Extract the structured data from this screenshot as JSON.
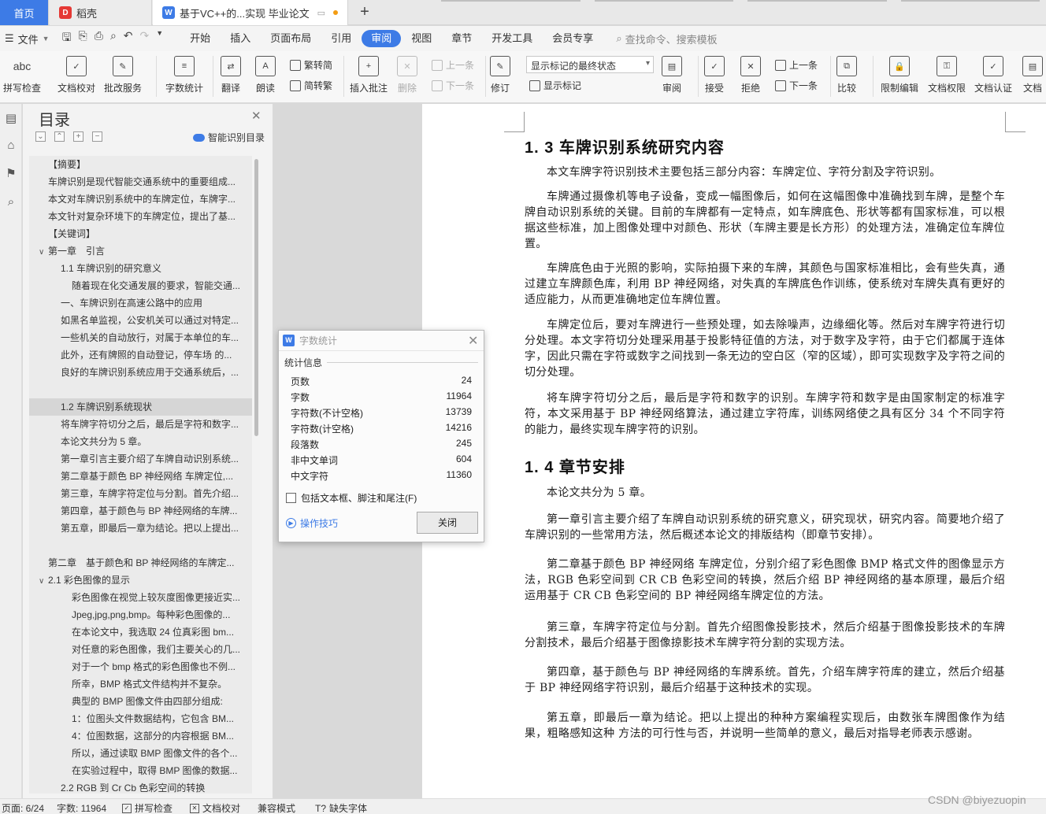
{
  "tabs": {
    "home": "首页",
    "docer": "稻壳",
    "doc": "基于VC++的...实现 毕业论文",
    "new_tab": "+"
  },
  "menu": {
    "file": "文件",
    "items": [
      "开始",
      "插入",
      "页面布局",
      "引用",
      "审阅",
      "视图",
      "章节",
      "开发工具",
      "会员专享"
    ],
    "active": "审阅",
    "search": "查找命令、搜索模板"
  },
  "ribbon": {
    "spell": "拼写检查",
    "proof": "文档校对",
    "review_svc": "批改服务",
    "wordcount": "字数统计",
    "translate": "翻译",
    "read_aloud": "朗读",
    "trad": "繁转简",
    "simp": "简转繁",
    "insert_comment": "插入批注",
    "delete": "删除",
    "prev_c": "上一条",
    "next_c": "下一条",
    "track": "修订",
    "mode": "显示标记的最终状态",
    "show_markup": "显示标记",
    "review": "审阅",
    "accept": "接受",
    "reject": "拒绝",
    "prev": "上一条",
    "next": "下一条",
    "compare": "比较",
    "restrict": "限制编辑",
    "perm": "文档权限",
    "cert": "文档认证",
    "doc_more": "文档"
  },
  "toc": {
    "title": "目录",
    "smart": "智能识别目录",
    "items": [
      {
        "t": "【摘要】",
        "lv": 1
      },
      {
        "t": "车牌识别是现代智能交通系统中的重要组成...",
        "lv": 1
      },
      {
        "t": "本文对车牌识别系统中的车牌定位，车牌字...",
        "lv": 1
      },
      {
        "t": "本文针对复杂环境下的车牌定位，提出了基...",
        "lv": 1
      },
      {
        "t": "【关键词】",
        "lv": 1
      },
      {
        "t": "第一章　引言",
        "lv": 0,
        "arrow": "v"
      },
      {
        "t": "1.1 车牌识别的研究意义",
        "lv": 2
      },
      {
        "t": "随着现在化交通发展的要求，智能交通...",
        "lv": 3
      },
      {
        "t": "一、车牌识别在高速公路中的应用",
        "lv": 2
      },
      {
        "t": "如黑名单监视，公安机关可以通过对特定...",
        "lv": 2
      },
      {
        "t": "一些机关的自动放行，对属于本单位的车...",
        "lv": 2
      },
      {
        "t": "此外，还有牌照的自动登记，停车场 的...",
        "lv": 2
      },
      {
        "t": "良好的车牌识别系统应用于交通系统后，...",
        "lv": 2
      },
      {
        "t": "",
        "lv": 2
      },
      {
        "t": "1.2 车牌识别系统现状",
        "lv": 2,
        "sel": true
      },
      {
        "t": "将车牌字符切分之后，最后是字符和数字...",
        "lv": 2
      },
      {
        "t": "本论文共分为 5 章。",
        "lv": 2
      },
      {
        "t": "第一章引言主要介绍了车牌自动识别系统...",
        "lv": 2
      },
      {
        "t": "第二章基于颜色 BP 神经网络  车牌定位,...",
        "lv": 2
      },
      {
        "t": "第三章，车牌字符定位与分割。首先介绍...",
        "lv": 2
      },
      {
        "t": "第四章，基于颜色与 BP 神经网络的车牌...",
        "lv": 2
      },
      {
        "t": "第五章，即最后一章为结论。把以上提出...",
        "lv": 2
      },
      {
        "t": "",
        "lv": 2
      },
      {
        "t": "第二章　基于颜色和 BP 神经网络的车牌定...",
        "lv": 1
      },
      {
        "t": "2.1 彩色图像的显示",
        "lv": 0,
        "arrow": "v"
      },
      {
        "t": "彩色图像在视觉上较灰度图像更接近实...",
        "lv": 3
      },
      {
        "t": "Jpeg,jpg,png,bmp。每种彩色图像的...",
        "lv": 3
      },
      {
        "t": "在本论文中，我选取 24 位真彩图 bm...",
        "lv": 3
      },
      {
        "t": "对任意的彩色图像，我们主要关心的几...",
        "lv": 3
      },
      {
        "t": "对于一个 bmp 格式的彩色图像也不例...",
        "lv": 3
      },
      {
        "t": "所幸，BMP 格式文件结构并不复杂。",
        "lv": 3
      },
      {
        "t": "典型的 BMP 图像文件由四部分组成:",
        "lv": 3
      },
      {
        "t": "1：位图头文件数据结构，它包含 BM...",
        "lv": 3
      },
      {
        "t": "4：位图数据，这部分的内容根据 BM...",
        "lv": 3
      },
      {
        "t": "所以，通过读取 BMP 图像文件的各个...",
        "lv": 3
      },
      {
        "t": "在实验过程中，取得 BMP 图像的数据...",
        "lv": 3
      },
      {
        "t": "2.2 RGB 到 Cr Cb 色彩空间的转换",
        "lv": 2
      }
    ]
  },
  "doc": {
    "h13": "1. 3 车牌识别系统研究内容",
    "p1": "本文车牌字符识别技术主要包括三部分内容：车牌定位、字符分割及字符识别。",
    "p2": "车牌通过摄像机等电子设备，变成一幅图像后，如何在这幅图像中准确找到车牌，是整个车牌自动识别系统的关键。目前的车牌都有一定特点，如车牌底色、形状等都有国家标准，可以根据这些标准，加上图像处理中对颜色、形状（车牌主要是长方形）的处理方法，准确定位车牌位置。",
    "p3": "车牌底色由于光照的影响，实际拍摄下来的车牌，其颜色与国家标准相比，会有些失真，通过建立车牌颜色库，利用 BP 神经网络，对失真的车牌底色作训练，使系统对车牌失真有更好的适应能力，从而更准确地定位车牌位置。",
    "p4": "车牌定位后，要对车牌进行一些预处理，如去除噪声，边缘细化等。然后对车牌字符进行切分处理。本文字符切分处理采用基于投影特征值的方法，对于数字及字符，由于它们都属于连体字，因此只需在字符或数字之间找到一条无边的空白区（窄的区域），即可实现数字及字符之间的切分处理。",
    "p5": "将车牌字符切分之后，最后是字符和数字的识别。车牌字符和数字是由国家制定的标准字符，本文采用基于 BP 神经网络算法，通过建立字符库，训练网络使之具有区分 34 个不同字符的能力，最终实现车牌字符的识别。",
    "h14": "1. 4 章节安排",
    "p6": "本论文共分为 5 章。",
    "p7": "第一章引言主要介绍了车牌自动识别系统的研究意义，研究现状，研究内容。简要地介绍了车牌识别的一些常用方法，然后概述本论文的排版结构（即章节安排）。",
    "p8": "第二章基于颜色 BP 神经网络  车牌定位，分别介绍了彩色图像 BMP 格式文件的图像显示方法，RGB 色彩空间到 CR CB 色彩空间的转换，然后介绍 BP 神经网络的基本原理，最后介绍运用基于 CR CB 色彩空间的 BP 神经网络车牌定位的方法。",
    "p9": "第三章，车牌字符定位与分割。首先介绍图像投影技术，然后介绍基于图像投影技术的车牌分割技术，最后介绍基于图像掠影技术车牌字符分割的实现方法。",
    "p10": "第四章，基于颜色与 BP 神经网络的车牌系统。首先，介绍车牌字符库的建立，然后介绍基于 BP 神经网络字符识别，最后介绍基于这种技术的实现。",
    "p11": "第五章，即最后一章为结论。把以上提出的种种方案编程实现后，由数张车牌图像作为结果，粗略感知这种 方法的可行性与否，并说明一些简单的意义，最后对指导老师表示感谢。"
  },
  "dialog": {
    "title": "字数统计",
    "section": "统计信息",
    "stats": [
      {
        "k": "页数",
        "v": "24"
      },
      {
        "k": "字数",
        "v": "11964"
      },
      {
        "k": "字符数(不计空格)",
        "v": "13739"
      },
      {
        "k": "字符数(计空格)",
        "v": "14216"
      },
      {
        "k": "段落数",
        "v": "245"
      },
      {
        "k": "非中文单词",
        "v": "604"
      },
      {
        "k": "中文字符",
        "v": "11360"
      }
    ],
    "checkbox": "包括文本框、脚注和尾注(F)",
    "tips": "操作技巧",
    "close": "关闭"
  },
  "status": {
    "page": "页面: 6/24",
    "words": "字数: 11964",
    "spell": "拼写检查",
    "proof": "文档校对",
    "compat": "兼容模式",
    "font": "缺失字体"
  },
  "watermark": "CSDN @biyezuopin",
  "colors": {
    "accent": "#3d7be6"
  }
}
